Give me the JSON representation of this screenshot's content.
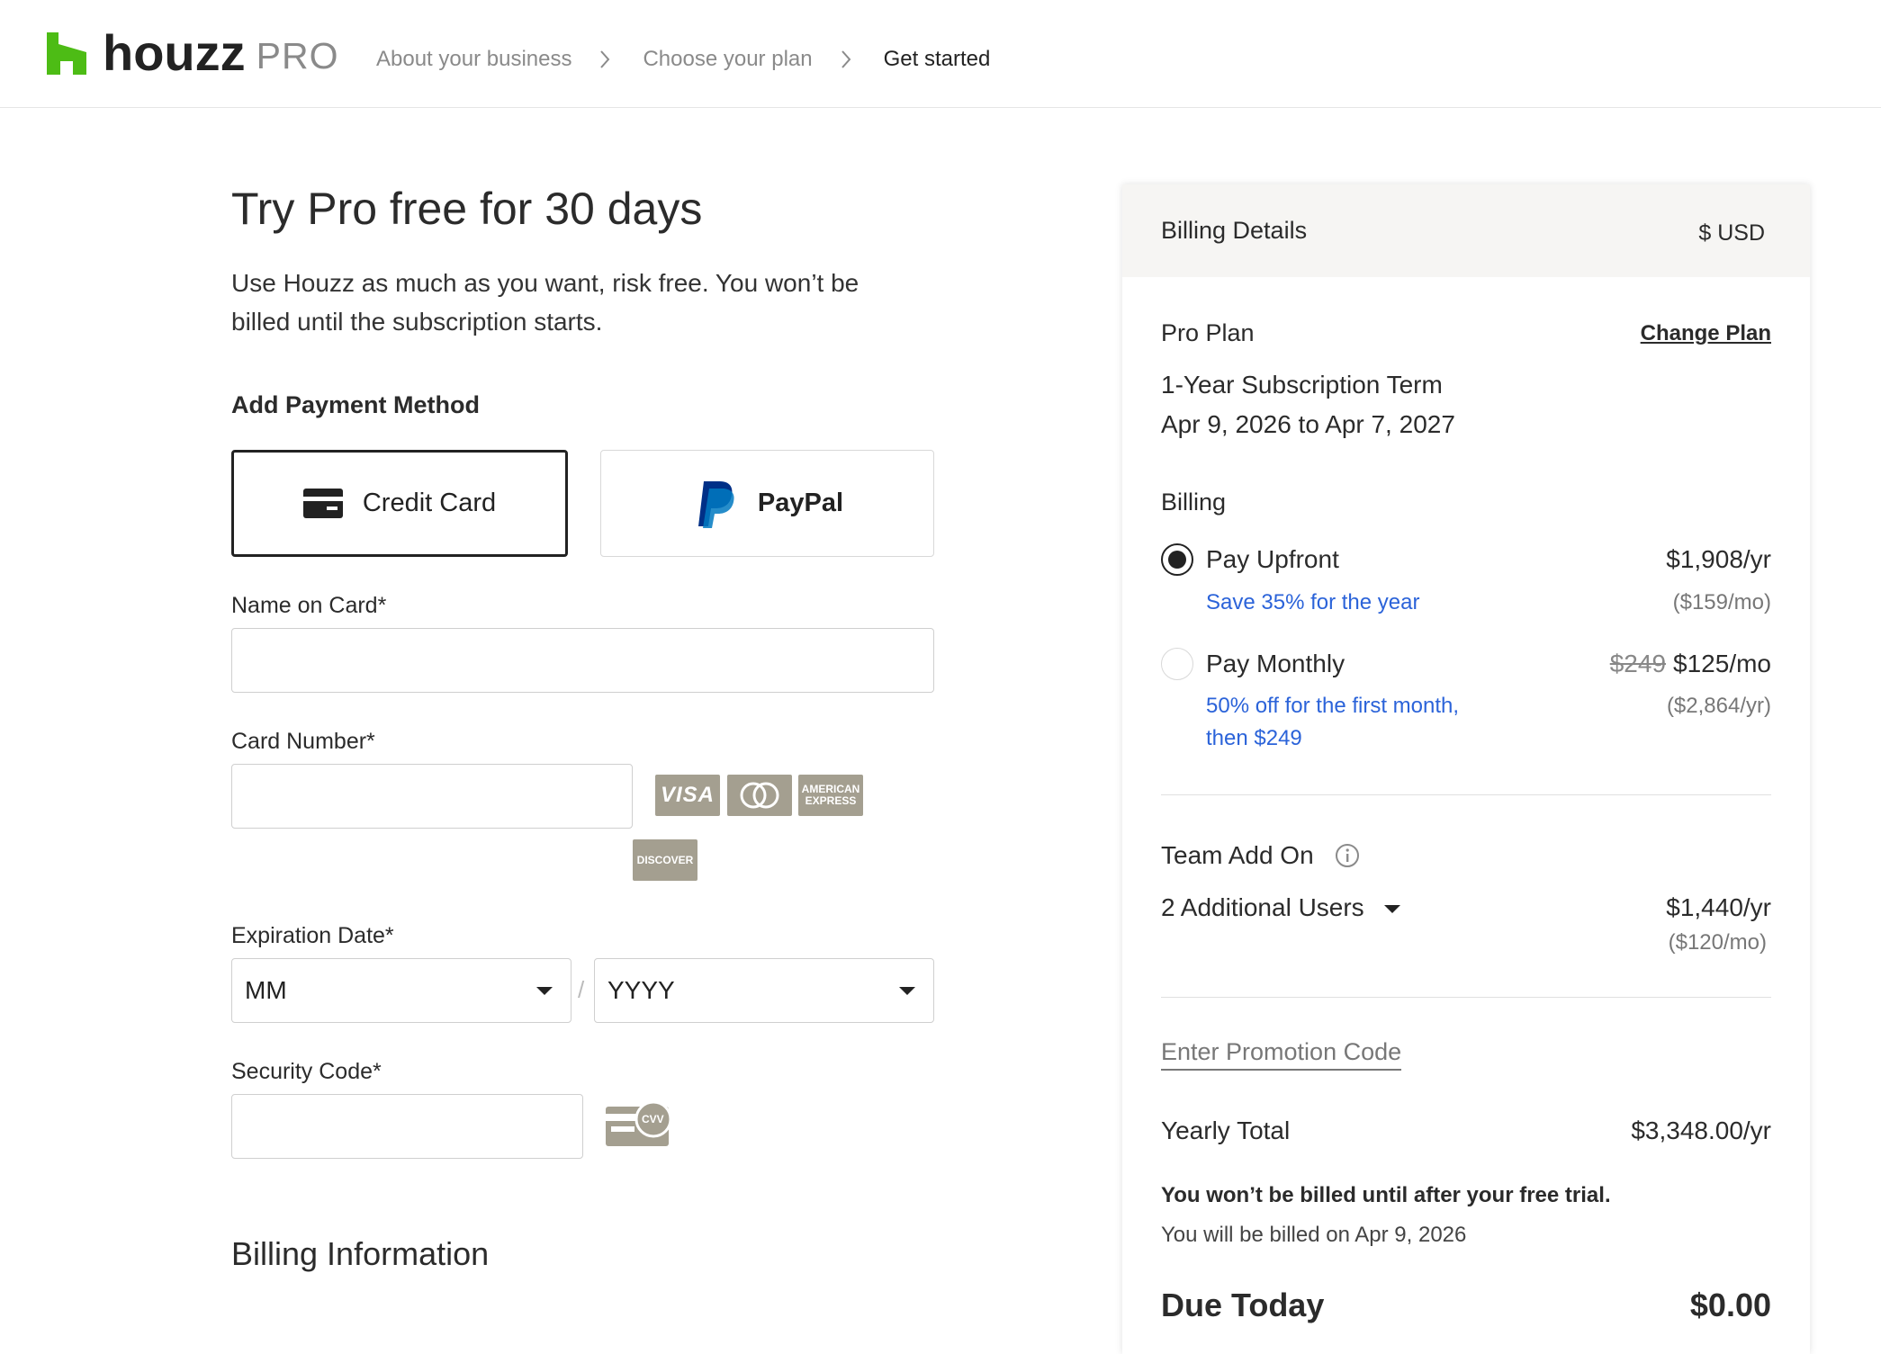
{
  "header": {
    "logo_word": "houzz",
    "logo_pro": "PRO",
    "brand_color": "#4dbc15",
    "breadcrumbs": [
      "About your business",
      "Choose your plan",
      "Get started"
    ]
  },
  "intro": {
    "title": "Try Pro free for 30 days",
    "subtitle": "Use Houzz as much as you want, risk free. You won’t be billed until the subscription starts."
  },
  "payment": {
    "section_label": "Add Payment Method",
    "methods": [
      {
        "label": "Credit Card",
        "icon": "credit-card-icon",
        "selected": true
      },
      {
        "label": "PayPal",
        "icon": "paypal-icon",
        "selected": false
      }
    ],
    "name_label": "Name on Card*",
    "name_value": "",
    "card_label": "Card Number*",
    "card_value": "",
    "card_brands": [
      "VISA",
      "mastercard",
      "AMERICAN EXPRESS",
      "DISCOVER"
    ],
    "expiration_label": "Expiration Date*",
    "month_value": "MM",
    "year_value": "YYYY",
    "date_separator": "/",
    "security_label": "Security Code*",
    "security_value": "",
    "cvv_badge": "CVV"
  },
  "billing_info_title": "Billing Information",
  "billing_details": {
    "title": "Billing Details",
    "currency": "$ USD",
    "plan_name": "Pro Plan",
    "change_plan": "Change Plan",
    "term": "1-Year Subscription Term",
    "dates": "Apr 9, 2026 to Apr 7, 2027",
    "billing_label": "Billing",
    "options": [
      {
        "label": "Pay Upfront",
        "price": "$1,908/yr",
        "sub_price": "($159/mo)",
        "note": "Save 35% for the year",
        "selected": true
      },
      {
        "label": "Pay Monthly",
        "old_price": "$249",
        "price": "$125/mo",
        "sub_price": "($2,864/yr)",
        "note_line1": "50% off for the first month,",
        "note_line2": "then $249",
        "selected": false
      }
    ],
    "team_label": "Team Add On",
    "team_select": "2 Additional Users",
    "team_price": "$1,440/yr",
    "team_sub_price": "($120/mo)",
    "promo_link": "Enter Promotion Code",
    "total_label": "Yearly Total",
    "total_value": "$3,348.00/yr",
    "trial_note": "You won’t be billed until after your free trial.",
    "billed_on": "You will be billed on Apr 9, 2026",
    "due_label": "Due Today",
    "due_value": "$0.00"
  },
  "colors": {
    "accent_blue": "#2b63d9",
    "card_brand_gray": "#a49f90",
    "paypal_dark": "#003087",
    "paypal_light": "#0079c1"
  }
}
